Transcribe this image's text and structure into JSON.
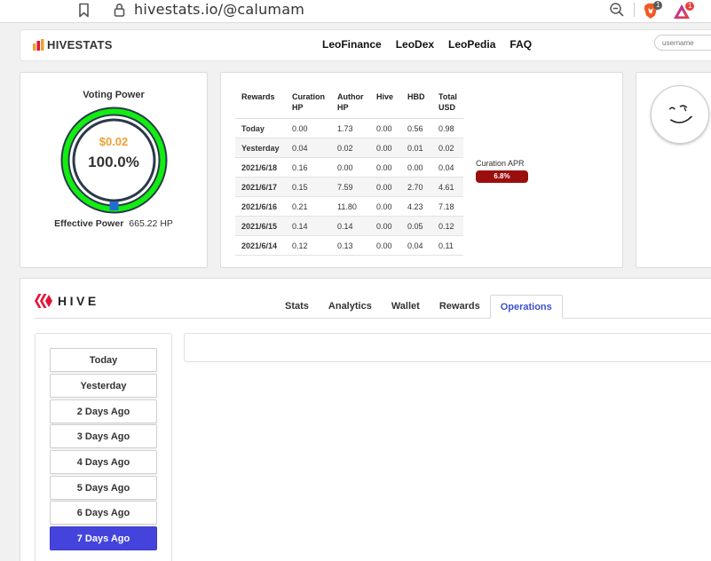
{
  "browser": {
    "url": "hivestats.io/@calumam",
    "brave_badge": "1",
    "rewards_badge": "1"
  },
  "nav": {
    "logo_text": "HIVESTATS",
    "links": [
      "LeoFinance",
      "LeoDex",
      "LeoPedia",
      "FAQ"
    ],
    "username_placeholder": "username"
  },
  "voting_power": {
    "title": "Voting Power",
    "value_usd": "$0.02",
    "percent": "100.0%",
    "percent_fraction": 1.0,
    "effective_label": "Effective Power",
    "effective_value": "665.22 HP"
  },
  "rewards": {
    "headers": [
      "Rewards",
      "Curation\nHP",
      "Author\nHP",
      "Hive",
      "HBD",
      "Total\nUSD"
    ],
    "rows": [
      [
        "Today",
        "0.00",
        "1.73",
        "0.00",
        "0.56",
        "0.98"
      ],
      [
        "Yesterday",
        "0.04",
        "0.02",
        "0.00",
        "0.01",
        "0.02"
      ],
      [
        "2021/6/18",
        "0.16",
        "0.00",
        "0.00",
        "0.00",
        "0.04"
      ],
      [
        "2021/6/17",
        "0.15",
        "7.59",
        "0.00",
        "2.70",
        "4.61"
      ],
      [
        "2021/6/16",
        "0.21",
        "11.80",
        "0.00",
        "4.23",
        "7.18"
      ],
      [
        "2021/6/15",
        "0.14",
        "0.14",
        "0.00",
        "0.05",
        "0.12"
      ],
      [
        "2021/6/14",
        "0.12",
        "0.13",
        "0.00",
        "0.04",
        "0.11"
      ]
    ],
    "apr_label": "Curation APR",
    "apr_value": "6.8%"
  },
  "hive": {
    "logo_text": "HIVE",
    "tabs": [
      "Stats",
      "Analytics",
      "Wallet",
      "Rewards",
      "Operations"
    ],
    "active_tab": "Operations",
    "days": [
      "Today",
      "Yesterday",
      "2 Days Ago",
      "3 Days Ago",
      "4 Days Ago",
      "5 Days Ago",
      "6 Days Ago",
      "7 Days Ago"
    ],
    "active_day": "7 Days Ago"
  },
  "colors": {
    "accent_blue": "#4444dd",
    "tab_active_text": "#3d52c9",
    "gauge_green": "#11ee11",
    "gauge_dark": "#2b3a4a",
    "apr_red": "#9b0e0e",
    "usd_orange": "#f0a030",
    "hive_red": "#e31337"
  }
}
